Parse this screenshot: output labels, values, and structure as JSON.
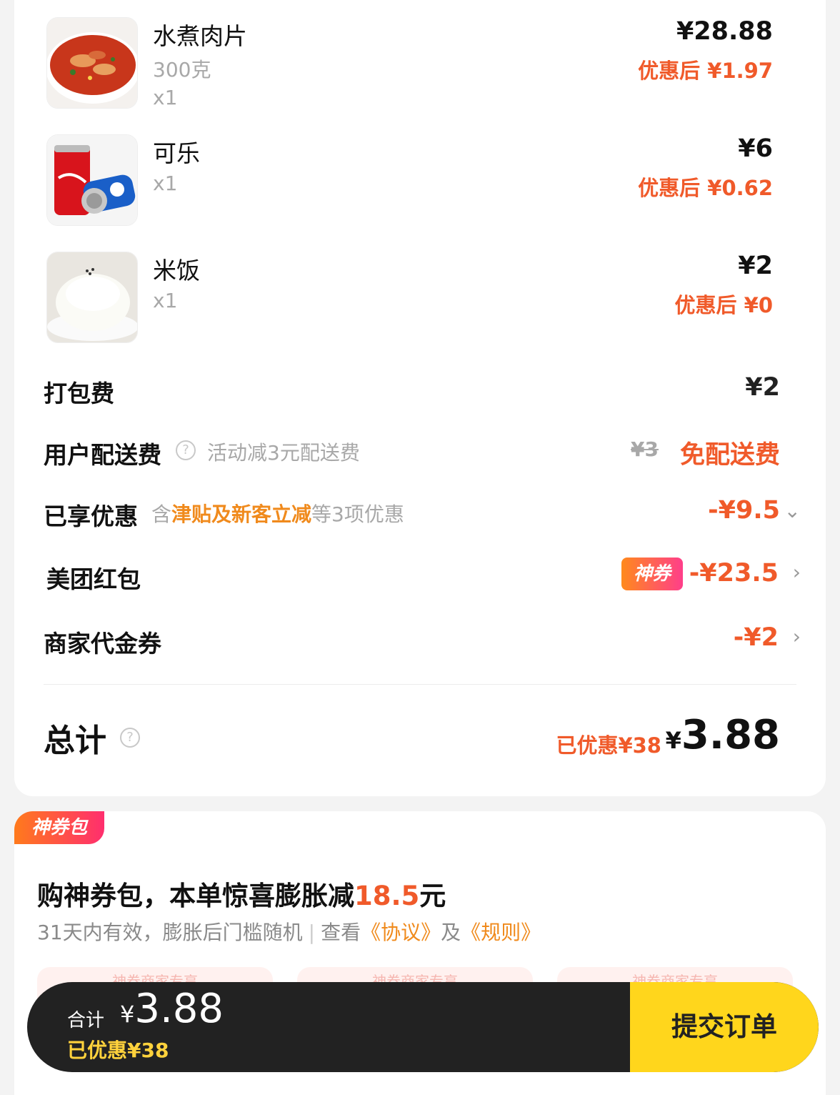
{
  "items": [
    {
      "name": "水煮肉片",
      "spec": "300克",
      "qty": "x1",
      "price": "¥28.88",
      "discounted": "优惠后 ¥1.97",
      "image": "boiled-pork-slices-image"
    },
    {
      "name": "可乐",
      "spec": "",
      "qty": "x1",
      "price": "¥6",
      "discounted": "优惠后 ¥0.62",
      "image": "cola-cans-image"
    },
    {
      "name": "米饭",
      "spec": "",
      "qty": "x1",
      "price": "¥2",
      "discounted": "优惠后 ¥0",
      "image": "rice-bowl-image"
    }
  ],
  "fees": {
    "packing": {
      "label": "打包费",
      "value": "¥2"
    },
    "delivery": {
      "label": "用户配送费",
      "note": "活动减3元配送费",
      "original": "¥3",
      "value": "免配送费"
    },
    "discounts": {
      "label": "已享优惠",
      "note_prefix": "含",
      "note_highlight": "津贴及新客立减",
      "note_suffix": "等3项优惠",
      "value": "-¥9.5"
    },
    "redpacket": {
      "label": "美团红包",
      "badge": "神券",
      "value": "-¥23.5"
    },
    "voucher": {
      "label": "商家代金券",
      "value": "-¥2"
    }
  },
  "total": {
    "label": "总计",
    "saved": "已优惠¥38",
    "value": "¥3.88",
    "yen": "¥",
    "amount": "3.88"
  },
  "pack": {
    "tag": "神券包",
    "title_prefix": "购神券包，本单惊喜膨胀减",
    "title_amount": "18.5",
    "title_suffix": "元",
    "sub_text": "31天内有效，膨胀后门槛随机",
    "sub_view": "查看",
    "link_agreement": "《协议》",
    "sub_and": "及",
    "link_rules": "《规则》",
    "card_label": "神券商家专享"
  },
  "bottom": {
    "total_label": "合计",
    "yen": "¥",
    "amount": "3.88",
    "saved": "已优惠¥38",
    "submit": "提交订单"
  },
  "colors": {
    "accent_red": "#f05a2a",
    "accent_orange": "#f08a1c",
    "submit_yellow": "#ffd61c",
    "bar_dark": "#222222"
  }
}
